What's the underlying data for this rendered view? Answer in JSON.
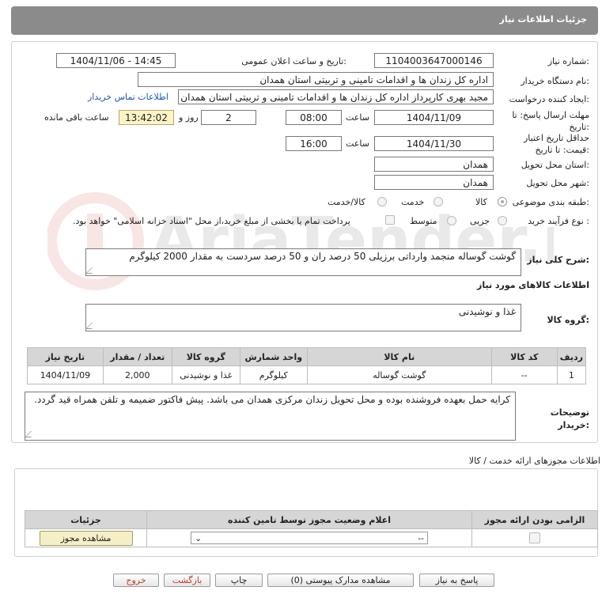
{
  "header": {
    "title": "جزئیات اطلاعات نیاز"
  },
  "watermark": {
    "text": "AriaTender.net"
  },
  "need_number": {
    "label": "شماره نیاز:",
    "value": "1104003647000146"
  },
  "announce": {
    "label": "تاریخ و ساعت اعلان عمومی:",
    "value": "1404/11/06 - 14:45"
  },
  "buyer_org": {
    "label": "نام دستگاه خریدار:",
    "value": "اداره کل زندان ها و اقدامات تامینی و تربیتی استان همدان"
  },
  "requester": {
    "label": "ایجاد کننده درخواست:",
    "value": "مجید بهری کارپرداز اداره کل زندان ها و اقدامات تامینی و تربیتی استان همدان",
    "contact_link": "اطلاعات تماس خریدار"
  },
  "reply_deadline": {
    "label": "مهلت ارسال پاسخ: تا تاریخ:",
    "date": "1404/11/09",
    "time_label": "ساعت",
    "time": "08:00",
    "days": "2",
    "days_label": "روز و",
    "remaining": "13:42:02",
    "remaining_label": "ساعت باقی مانده"
  },
  "price_validity": {
    "label": "حداقل تاریخ اعتبار قیمت: تا تاریخ:",
    "date": "1404/11/30",
    "time_label": "ساعت",
    "time": "16:00"
  },
  "delivery_province": {
    "label": "استان محل تحویل:",
    "value": "همدان"
  },
  "delivery_city": {
    "label": "شهر محل تحویل:",
    "value": "همدان"
  },
  "category": {
    "label": "طبقه بندی موضوعی:",
    "options": [
      "کالا",
      "خدمت",
      "کالا/خدمت"
    ],
    "selected": "کالا"
  },
  "purchase_type": {
    "label": "نوع فرآیند خرید :",
    "options": [
      "جزیی",
      "متوسط"
    ],
    "note": "پرداخت تمام یا بخشی از مبلغ خرید،از محل \"اسناد خزانه اسلامی\" خواهد بود."
  },
  "description": {
    "label": "شرح کلی نیاز:",
    "value": "گوشت گوساله منجمد وارداتی برزیلی 50 درصد ران و 50 درصد سردست به مقدار 2000 کیلوگرم"
  },
  "goods_section": {
    "title": "اطلاعات کالاهای مورد نیاز",
    "group_label": "گروه کالا:",
    "group_value": "غذا و نوشیدنی"
  },
  "items_table": {
    "headers": [
      "ردیف",
      "کد کالا",
      "نام کالا",
      "واحد شمارش",
      "گروه کالا",
      "تعداد / مقدار",
      "تاریخ نیاز"
    ],
    "rows": [
      [
        "1",
        "--",
        "گوشت گوساله",
        "کیلوگرم",
        "غذا و نوشیدنی",
        "2,000",
        "1404/11/09"
      ]
    ]
  },
  "buyer_notes": {
    "label": "توضیحات خریدار:",
    "value": "کرایه حمل بعهده فروشنده بوده و محل تحویل زندان مرکزی همدان می باشد. پیش فاکتور ضمیمه و تلفن همراه قید گردد."
  },
  "permits": {
    "title": "اطلاعات مجوزهای ارائه خدمت / کالا",
    "headers": [
      "الزامی بودن ارائه مجوز",
      "اعلام وضعیت مجوز توسط تامین کننده",
      "جزئیات"
    ],
    "select_value": "--",
    "view_button": "مشاهده مجوز"
  },
  "footer_buttons": {
    "reply": "پاسخ به نیاز",
    "attachments": "مشاهده مدارک پیوستی (0)",
    "print": "چاپ",
    "back": "بازگشت",
    "exit": "خروج"
  }
}
